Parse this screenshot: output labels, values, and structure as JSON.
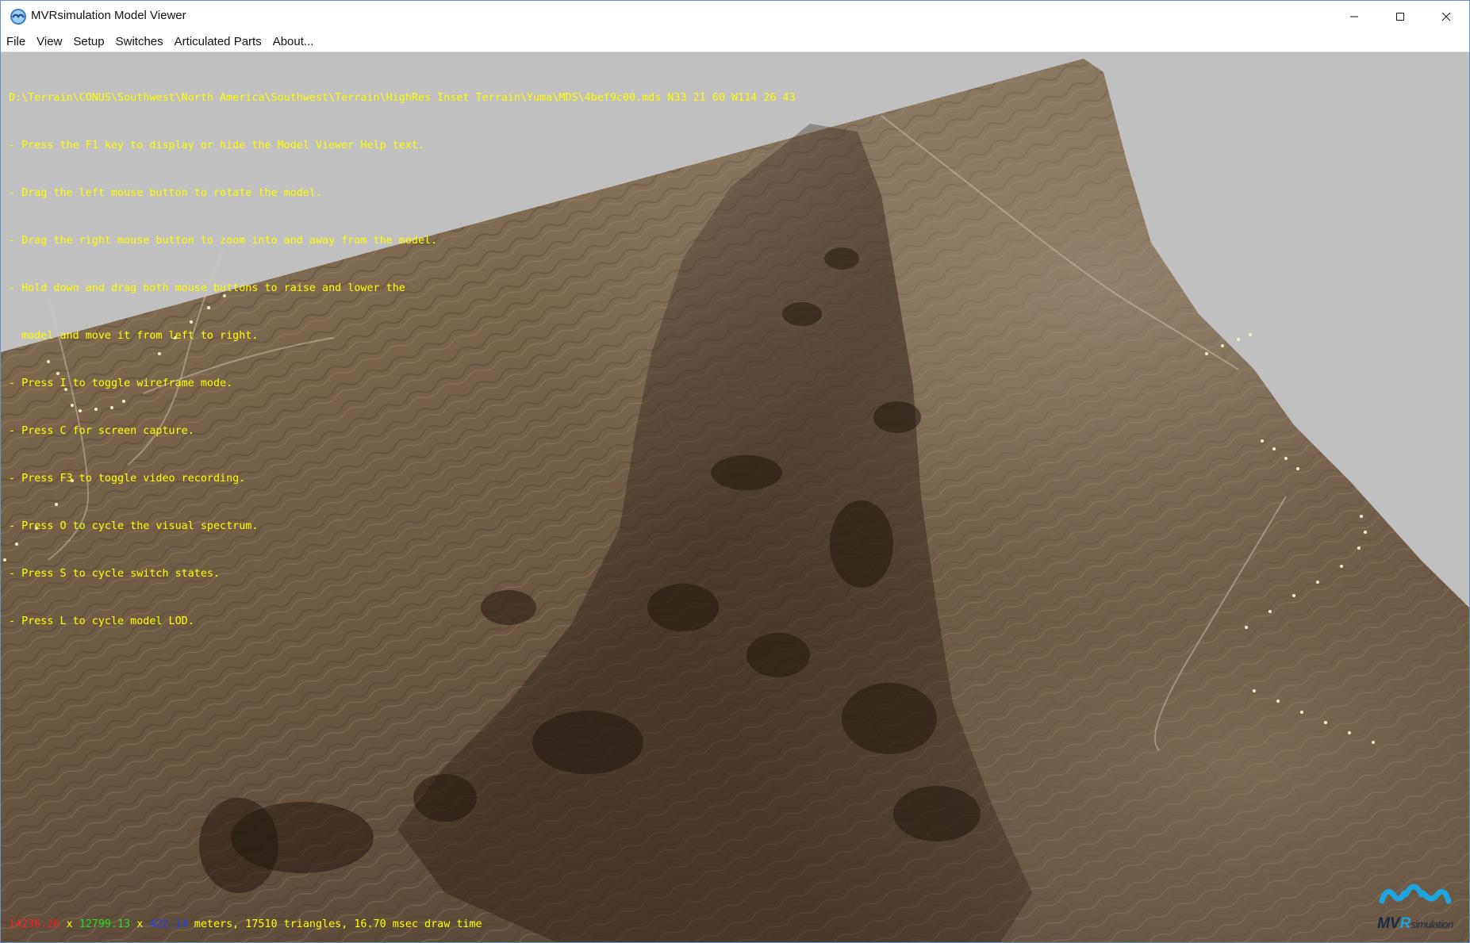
{
  "window": {
    "title": "MVRsimulation Model Viewer",
    "app_icon": "mvr-app-icon",
    "controls": {
      "minimize_icon": "minimize-icon",
      "maximize_icon": "maximize-icon",
      "close_icon": "close-icon"
    }
  },
  "menu": {
    "items": [
      "File",
      "View",
      "Setup",
      "Switches",
      "Articulated Parts",
      "About..."
    ]
  },
  "overlay": {
    "path_line": "D:\\Terrain\\CONUS\\Southwest\\North America\\Southwest\\Terrain\\HighRes Inset Terrain\\Yuma\\MDS\\4bef9c00.mds N33 21 60 W114 26 43",
    "help_lines": [
      "- Press the F1 key to display or hide the Model Viewer Help text.",
      "- Drag the left mouse button to rotate the model.",
      "- Drag the right mouse button to zoom into and away from the model.",
      "- Hold down and drag both mouse buttons to raise and lower the",
      "  model and move it from left to right.",
      "- Press I to toggle wireframe mode.",
      "- Press C for screen capture.",
      "- Press F3 to toggle video recording.",
      "- Press O to cycle the visual spectrum.",
      "- Press S to cycle switch states.",
      "- Press L to cycle model LOD."
    ],
    "text_color": "#ffff00"
  },
  "stats": {
    "x_extent": "14236.26",
    "sep1": " x ",
    "y_extent": "12799.13",
    "sep2": " x ",
    "z_extent": "422.14",
    "summary": " meters, 17510 triangles, 16.70 msec draw time",
    "colors": {
      "x": "#ff2020",
      "y": "#20e020",
      "z": "#2040ff",
      "text": "#ffff00"
    }
  },
  "logo": {
    "part1": "MV",
    "part2": "R",
    "part3": "simulation",
    "icon": "mvr-logo-icon"
  },
  "viewport": {
    "background": "#c0c0c0",
    "content": "3D terrain model render"
  }
}
